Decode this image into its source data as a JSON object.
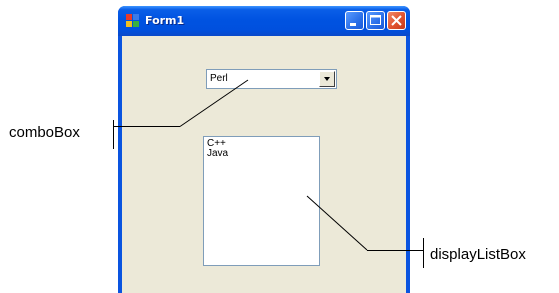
{
  "window": {
    "title": "Form1",
    "icon": "form-app-icon",
    "controls": {
      "minimize": "minimize-icon",
      "maximize": "maximize-icon",
      "close": "close-icon"
    },
    "colors": {
      "titlebar": "#0053e1",
      "client": "#ece9d8",
      "close_button": "#e0522e"
    }
  },
  "combo_box": {
    "selected_value": "Perl"
  },
  "list_box": {
    "items": [
      "C++",
      "Java"
    ]
  },
  "callouts": {
    "combo_label": "comboBox",
    "list_label": "displayListBox"
  }
}
